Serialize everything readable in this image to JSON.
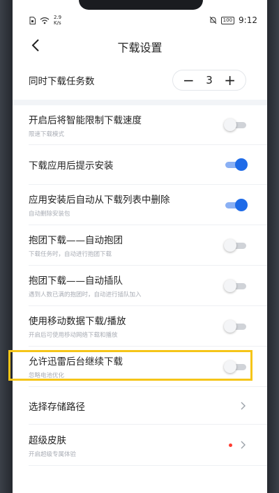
{
  "status_bar": {
    "speed_value": "2.9",
    "speed_unit": "K/s",
    "battery": "100",
    "time": "9:12"
  },
  "header": {
    "title": "下载设置",
    "back_icon": "chevron-left-icon"
  },
  "concurrent": {
    "label": "同时下载任务数",
    "value": "3",
    "minus": "−",
    "plus": "+"
  },
  "settings": [
    {
      "label": "开启后将智能限制下载速度",
      "sub": "限速下载模式",
      "on": false
    },
    {
      "label": "下载应用后提示安装",
      "sub": "",
      "on": true
    },
    {
      "label": "应用安装后自动从下载列表中删除",
      "sub": "自动删除安装包",
      "on": true
    },
    {
      "label": "抱团下载——自动抱团",
      "sub": "下载任务时，自动进行抱团下载",
      "on": false
    },
    {
      "label": "抱团下载——自动插队",
      "sub": "遇到人数已满的抱团时，自动进行插队加入",
      "on": false
    },
    {
      "label": "使用移动数据下载/播放",
      "sub": "开启后可使用移动网络下载和播放",
      "on": false
    },
    {
      "label": "允许迅雷后台继续下载",
      "sub": "忽略电池优化",
      "on": false
    }
  ],
  "storage": {
    "label": "选择存储路径"
  },
  "skin": {
    "label": "超级皮肤",
    "sub": "开启超级专属体验"
  },
  "colors": {
    "accent": "#1f6be8",
    "highlight": "#f5c518",
    "badge": "#ff3b30"
  }
}
